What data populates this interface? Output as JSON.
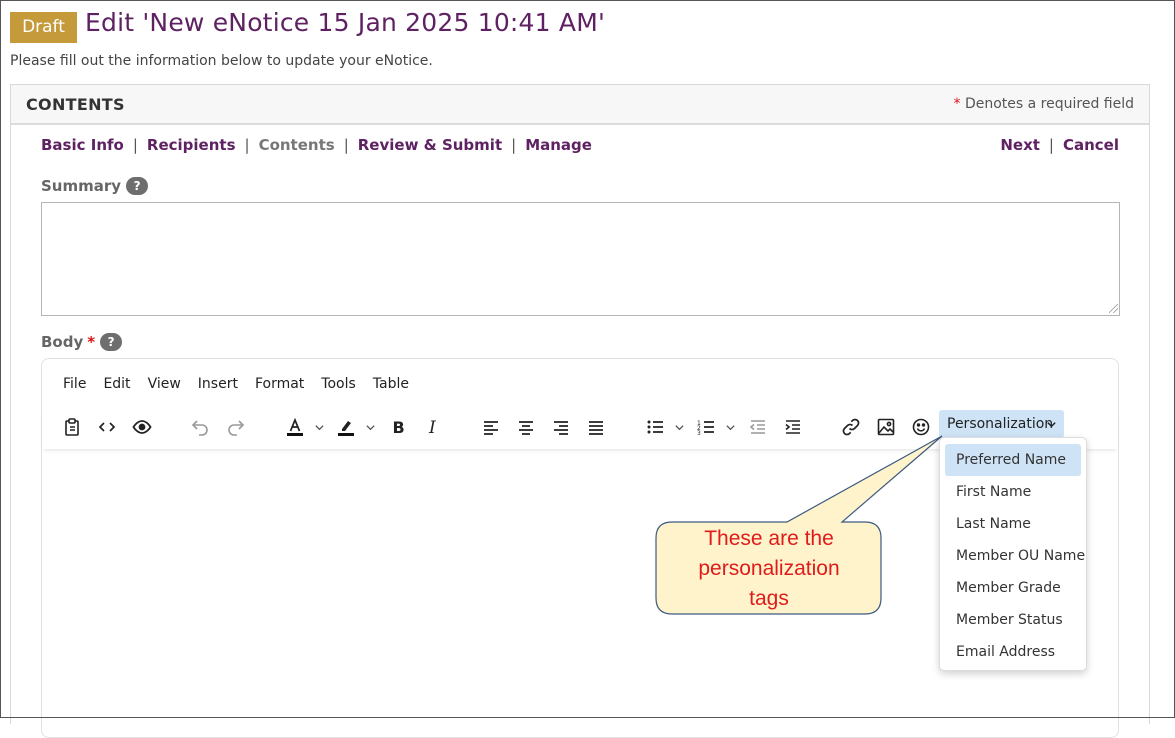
{
  "header": {
    "status_badge": "Draft",
    "title": "Edit 'New eNotice 15 Jan 2025 10:41 AM'",
    "instructions": "Please fill out the information below to update your eNotice."
  },
  "panel": {
    "title": "CONTENTS",
    "required_star": "*",
    "required_note": "Denotes a required field"
  },
  "steps": [
    {
      "label": "Basic Info"
    },
    {
      "label": "Recipients"
    },
    {
      "label": "Contents",
      "current": true
    },
    {
      "label": "Review & Submit"
    },
    {
      "label": "Manage"
    }
  ],
  "actions": {
    "next": "Next",
    "cancel": "Cancel"
  },
  "summary": {
    "label": "Summary",
    "help": "?",
    "value": ""
  },
  "body": {
    "label": "Body",
    "required": "*",
    "help": "?"
  },
  "editor": {
    "menu": [
      "File",
      "Edit",
      "View",
      "Insert",
      "Format",
      "Tools",
      "Table"
    ],
    "toolbar_icons": [
      "paste-icon",
      "source-code-icon",
      "preview-icon",
      "undo-icon",
      "redo-icon",
      "text-color-icon",
      "highlight-icon",
      "bold-icon",
      "italic-icon",
      "align-left-icon",
      "align-center-icon",
      "align-right-icon",
      "justify-icon",
      "bullet-list-icon",
      "numbered-list-icon",
      "outdent-icon",
      "indent-icon",
      "link-icon",
      "image-icon",
      "emoticon-icon"
    ],
    "personalization_label": "Personalization"
  },
  "personalization_menu": {
    "items": [
      "Preferred Name",
      "First Name",
      "Last Name",
      "Member OU Name",
      "Member Grade",
      "Member Status",
      "Email Address"
    ],
    "highlighted": "Preferred Name"
  },
  "callout": {
    "line1": "These are the",
    "line2": "personalization",
    "line3": "tags"
  },
  "colors": {
    "brand": "#5e2262",
    "badge": "#c59a3a",
    "required": "#d11111",
    "callout_fill": "#fff3cc",
    "callout_text": "#e01b1b",
    "menu_highlight": "#cfe3f7"
  }
}
